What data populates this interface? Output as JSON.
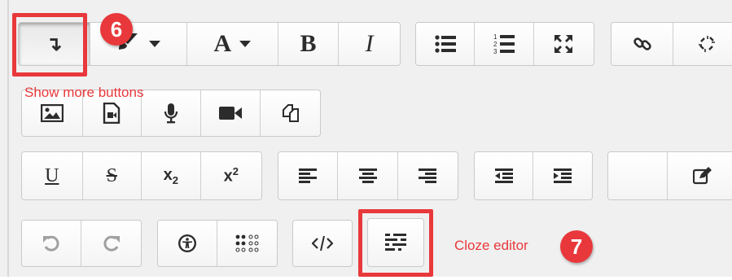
{
  "toolbar": {
    "rows": [
      {
        "group1": [
          {
            "name": "show-more-buttons",
            "icon": "arrow-down-turn-icon",
            "glyph": "↴"
          },
          {
            "name": "color",
            "icon": "paint-brush-icon"
          },
          {
            "name": "font",
            "icon": "text-color-icon",
            "label": "A"
          },
          {
            "name": "bold",
            "icon": "bold-icon",
            "label": "B"
          },
          {
            "name": "italic",
            "icon": "italic-icon",
            "label": "I"
          }
        ],
        "group2": [
          "unordered-list-icon",
          "ordered-list-icon",
          "fullscreen-icon"
        ],
        "group3": [
          "link-icon",
          "unlink-icon"
        ]
      },
      {
        "group1": [
          "image-icon",
          "media-icon",
          "microphone-icon",
          "video-icon",
          "manage-files-icon"
        ]
      },
      {
        "group1": [
          {
            "name": "underline",
            "label": "U"
          },
          {
            "name": "strikethrough",
            "label": "S"
          },
          {
            "name": "subscript",
            "label": "x₂"
          },
          {
            "name": "superscript",
            "label": "x²"
          }
        ],
        "group2": [
          "align-left-icon",
          "align-center-icon",
          "align-right-icon"
        ],
        "group3": [
          "outdent-icon",
          "indent-icon"
        ],
        "group4": [
          "edit-icon"
        ]
      },
      {
        "group1": [
          "undo-icon",
          "redo-icon"
        ],
        "group2": [
          "accessibility-checker-icon",
          "screenreader-helper-icon"
        ],
        "group3": [
          "html-icon"
        ],
        "group4": [
          "cloze-editor-icon"
        ]
      }
    ]
  },
  "labels": {
    "bold": "B",
    "italic": "I",
    "font": "A",
    "underline": "U",
    "strike": "S",
    "sub_base": "x",
    "sub_index": "2",
    "sup_base": "x",
    "sup_index": "2",
    "more": "↴"
  },
  "annotations": {
    "badge_6": "6",
    "badge_7": "7",
    "show_more_note": "Show more buttons",
    "cloze_note": "Cloze editor",
    "highlight_color": "#e8383b"
  }
}
